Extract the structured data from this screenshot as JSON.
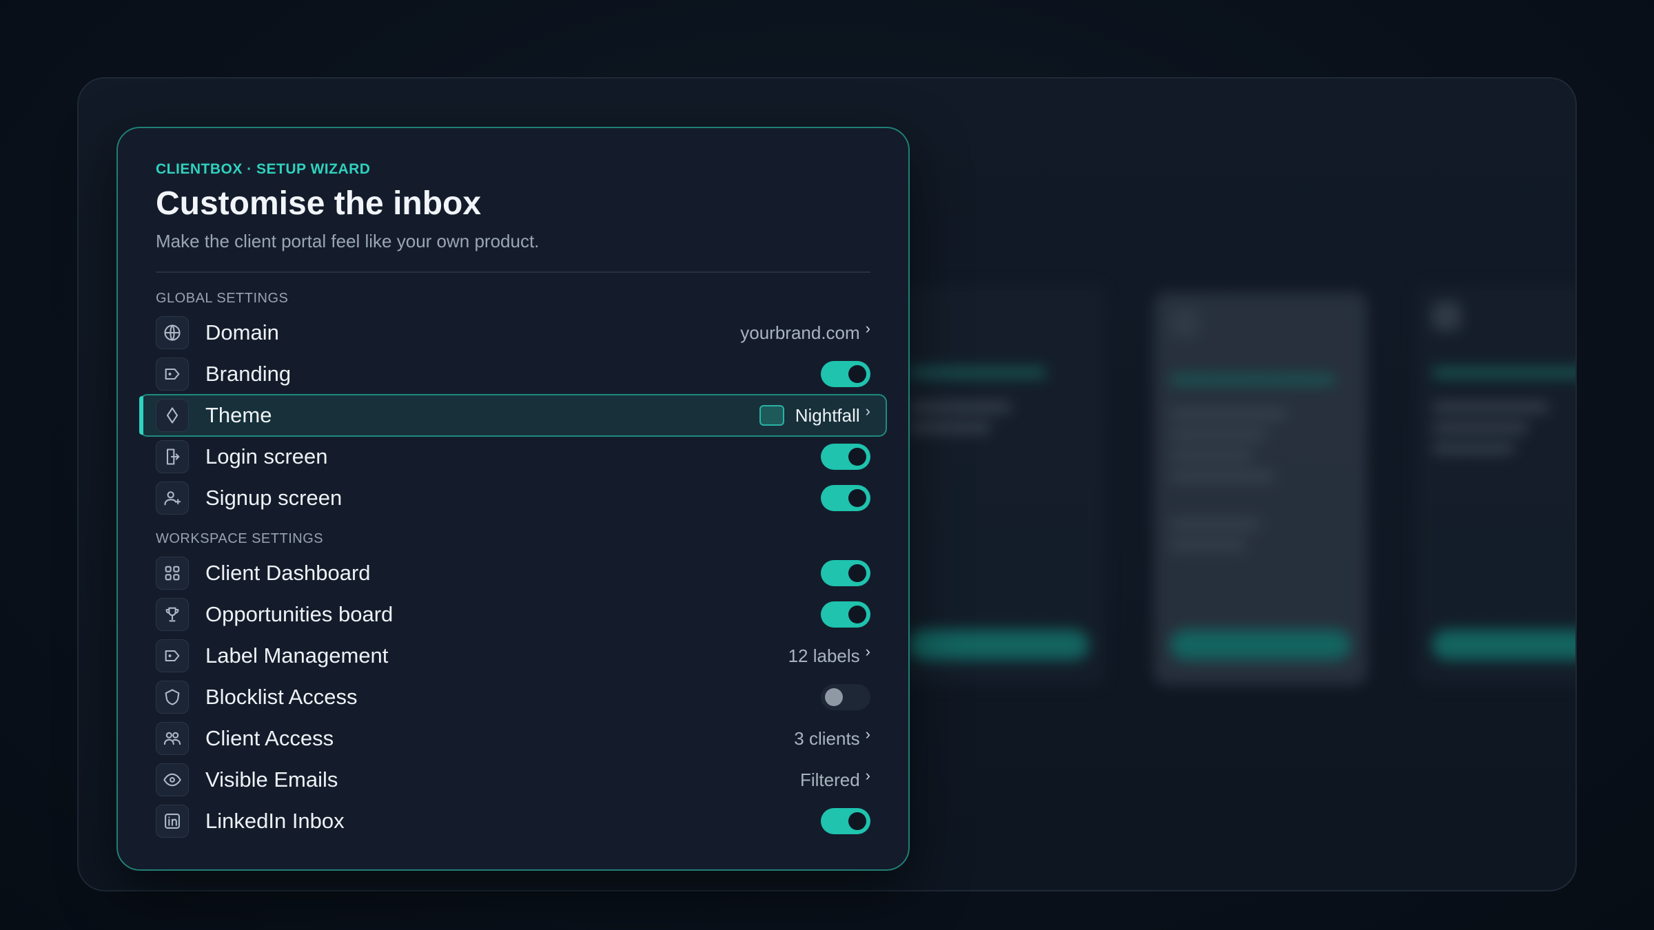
{
  "header": {
    "eyebrow": "CLIENTBOX · SETUP WIZARD",
    "title": "Customise the inbox",
    "subtitle": "Make the client portal feel like your own product."
  },
  "global": {
    "section_label": "GLOBAL SETTINGS",
    "items": [
      {
        "label": "Domain",
        "icon": "globe-icon",
        "value": "yourbrand.com"
      },
      {
        "label": "Branding",
        "icon": "tag-icon",
        "toggle": true
      },
      {
        "label": "Theme",
        "icon": "diamond-icon",
        "value": "Nightfall",
        "selected": true
      },
      {
        "label": "Login screen",
        "icon": "login-icon",
        "toggle": true
      },
      {
        "label": "Signup screen",
        "icon": "user-plus-icon",
        "toggle": true
      }
    ]
  },
  "workspace": {
    "section_label": "WORKSPACE SETTINGS",
    "items": [
      {
        "label": "Client Dashboard",
        "icon": "grid-icon",
        "toggle": true
      },
      {
        "label": "Opportunities board",
        "icon": "trophy-icon",
        "toggle": true
      },
      {
        "label": "Label Management",
        "icon": "tag-icon",
        "value": "12 labels"
      },
      {
        "label": "Blocklist Access",
        "icon": "shield-icon",
        "toggle": false
      },
      {
        "label": "Client Access",
        "icon": "users-icon",
        "value": "3 clients"
      },
      {
        "label": "Visible Emails",
        "icon": "eye-icon",
        "value": "Filtered"
      },
      {
        "label": "LinkedIn Inbox",
        "icon": "linkedin-icon",
        "toggle": true
      }
    ]
  },
  "colors": {
    "accent": "#2dd4bf",
    "toggle_on": "#1fc3ae",
    "panel_bg": "#141c2b",
    "theme_swatch": "#1e5a5a"
  }
}
